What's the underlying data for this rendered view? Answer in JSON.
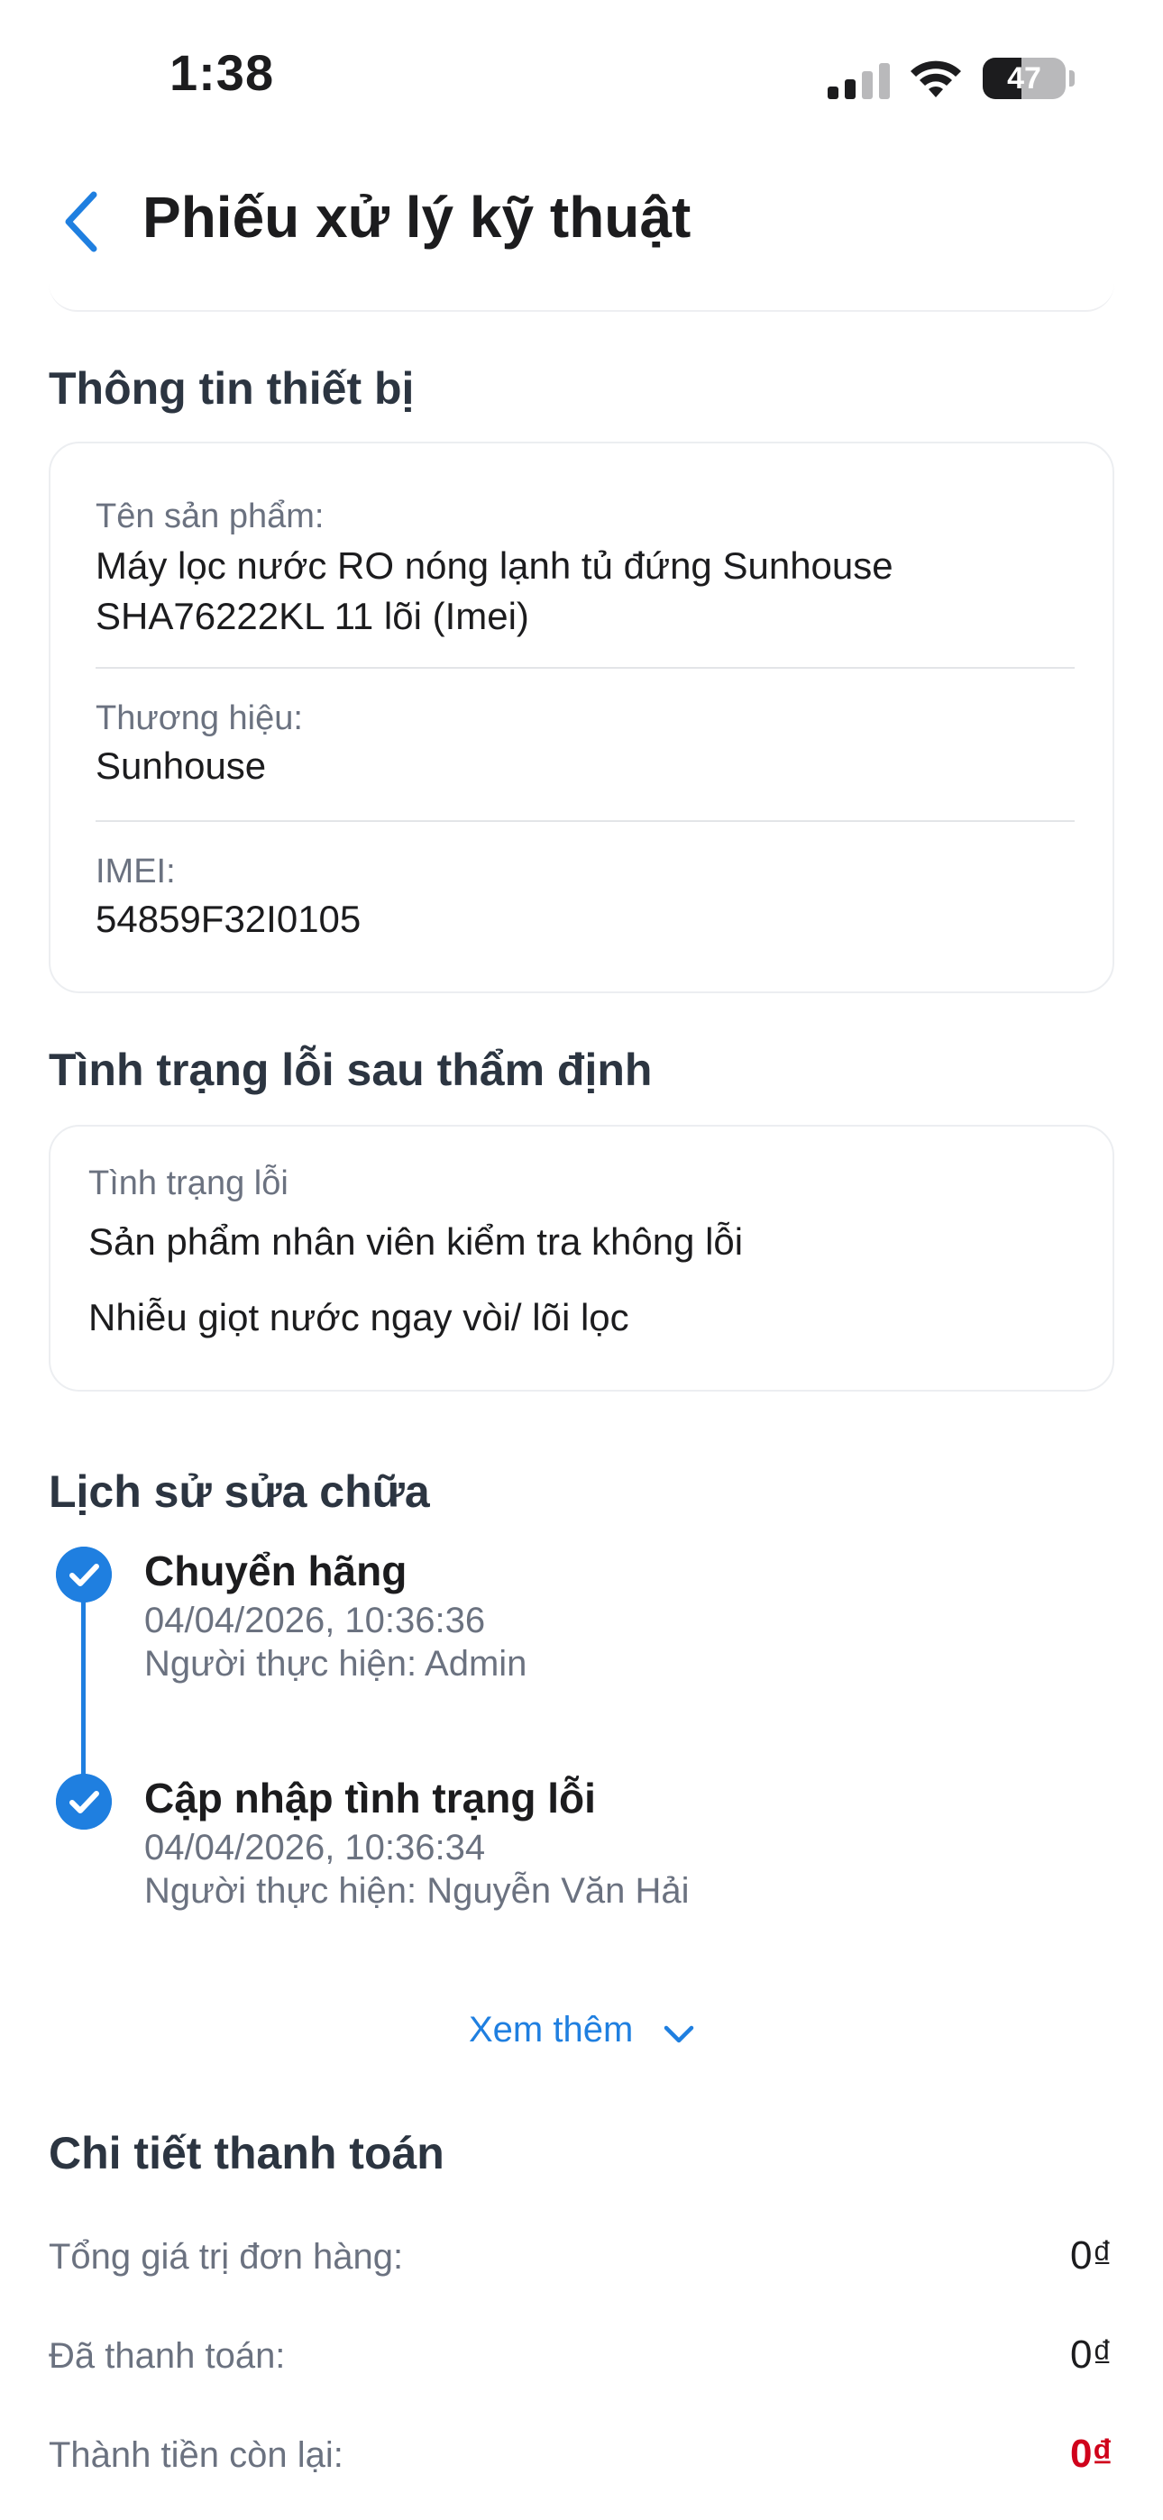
{
  "status_bar": {
    "time": "1:38",
    "battery_level": "47",
    "battery_fraction": 0.47
  },
  "header": {
    "title": "Phiếu xử lý kỹ thuật",
    "back_icon": "chevron-left-icon"
  },
  "device_info": {
    "section_title": "Thông tin thiết bị",
    "product_label": "Tên sản phẩm:",
    "product_value": "Máy lọc nước RO nóng lạnh tủ đứng Sunhouse SHA76222KL 11 lõi (Imei)",
    "brand_label": "Thương hiệu:",
    "brand_value": "Sunhouse",
    "imei_label": "IMEI:",
    "imei_value": "54859F32I0105"
  },
  "fault_status": {
    "section_title": "Tình trạng lỗi sau thẩm định",
    "label": "Tình trạng lỗi",
    "lines": [
      "Sản phẩm nhân viên kiểm tra không lỗi",
      "Nhiễu giọt nước ngay vòi/ lõi lọc"
    ]
  },
  "repair_history": {
    "section_title": "Lịch sử sửa chữa",
    "entries": [
      {
        "title": "Chuyển hãng",
        "time": "04/04/2026, 10:36:36",
        "actor": "Người thực hiện: Admin"
      },
      {
        "title": "Cập nhập tình trạng lỗi",
        "time": "04/04/2026, 10:36:34",
        "actor": "Người thực hiện: Nguyễn Văn Hải"
      }
    ],
    "see_more": "Xem thêm"
  },
  "payment": {
    "section_title": "Chi tiết thanh toán",
    "rows": [
      {
        "label": "Tổng giá trị đơn hàng:",
        "value": "0₫"
      },
      {
        "label": "Đã thanh toán:",
        "value": "0₫"
      },
      {
        "label": "Thành tiền còn lại:",
        "value": "0₫"
      }
    ]
  },
  "colors": {
    "accent": "#1f7fe0",
    "danger": "#d0021b"
  }
}
